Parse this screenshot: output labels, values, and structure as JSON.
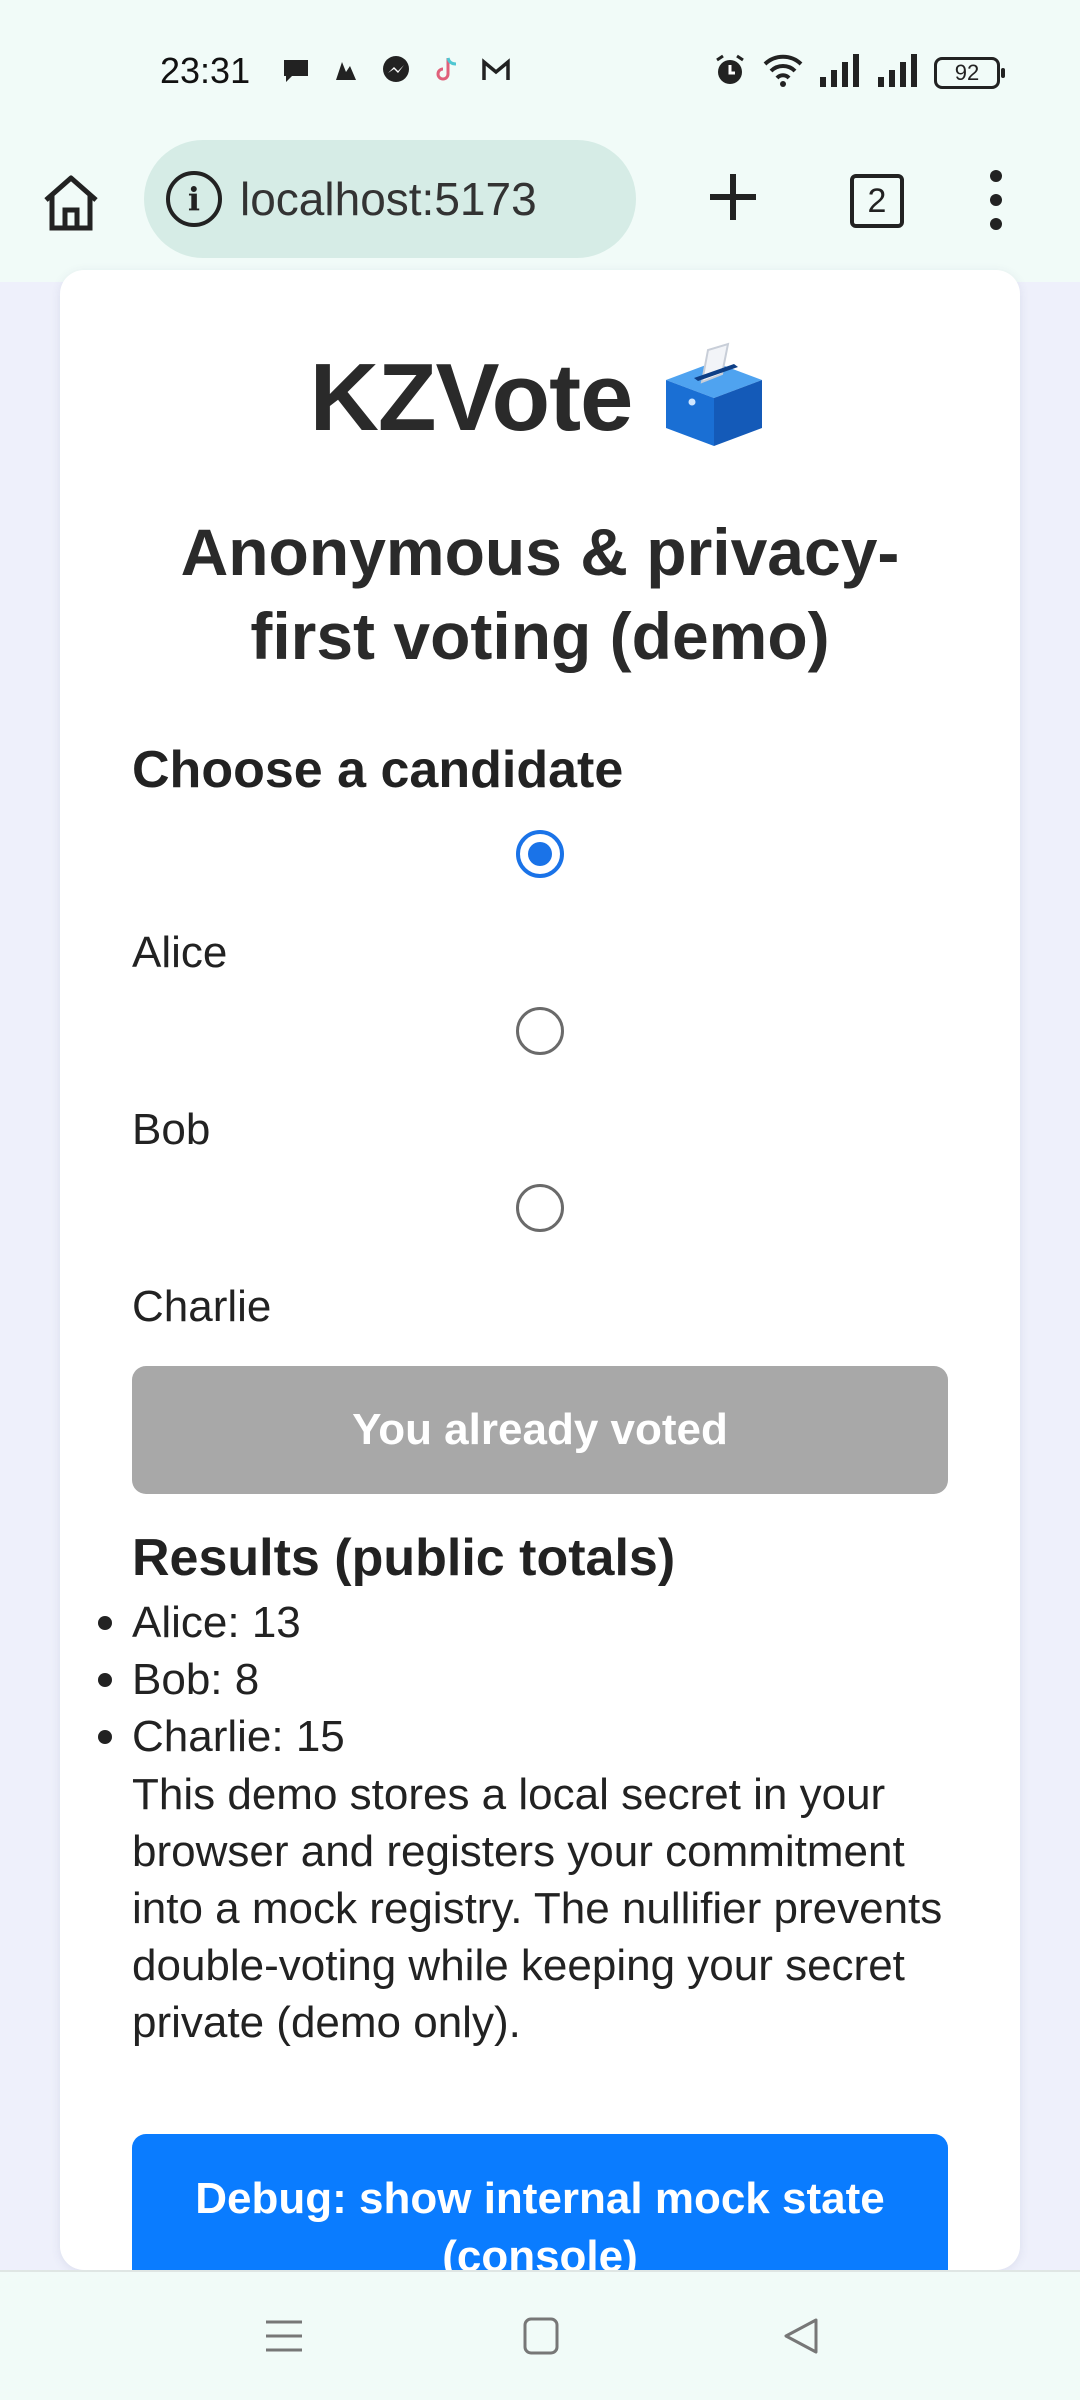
{
  "status_bar": {
    "time": "23:31",
    "notification_icons": [
      "chat-bubble-icon",
      "app-icon",
      "messenger-icon",
      "tiktok-icon",
      "gmail-icon"
    ],
    "battery": "92"
  },
  "browser": {
    "url": "localhost:5173",
    "tab_count": "2"
  },
  "page": {
    "title": "KZVote",
    "title_emoji": "ballot-box-icon",
    "subtitle": "Anonymous & privacy-first voting (demo)",
    "choose_heading": "Choose a candidate",
    "candidates": [
      {
        "label": "Alice",
        "selected": true
      },
      {
        "label": "Bob",
        "selected": false
      },
      {
        "label": "Charlie",
        "selected": false
      }
    ],
    "vote_button": "You already voted",
    "results_heading": "Results (public totals)",
    "results": [
      "Alice: 13",
      "Bob: 8",
      "Charlie: 15"
    ],
    "note": "This demo stores a local secret in your browser and registers your commitment into a mock registry. The nullifier prevents double-voting while keeping your secret private (demo only).",
    "debug_button": "Debug: show internal mock state (console)"
  },
  "colors": {
    "accent": "#1a73e8",
    "debug_button": "#0a7cff",
    "disabled_button": "#a8a8a8",
    "chrome_bg": "#f1fbf8",
    "page_bg": "#eef0fb"
  }
}
